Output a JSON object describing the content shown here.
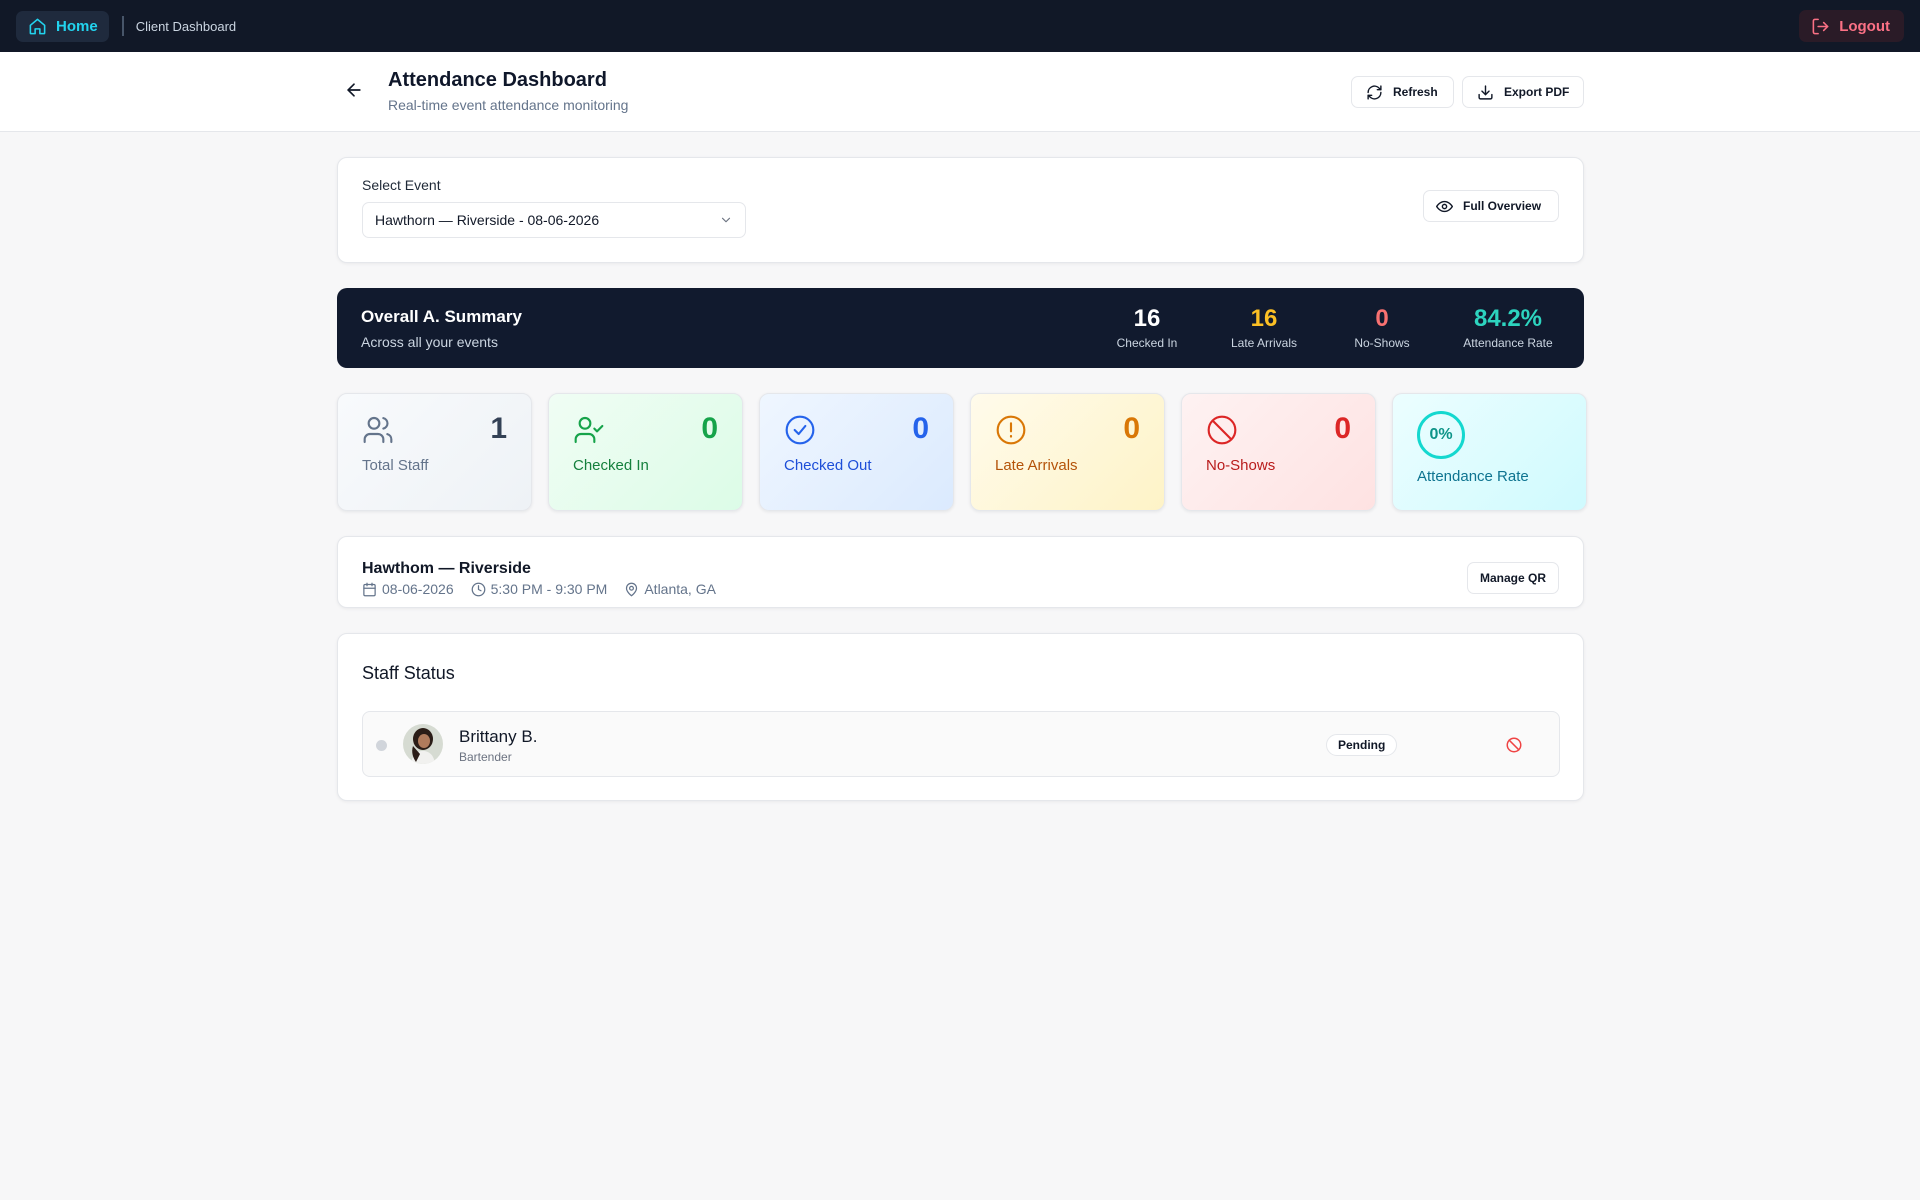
{
  "nav": {
    "home_label": "Home",
    "breadcrumb": "Client Dashboard",
    "logout_label": "Logout"
  },
  "header": {
    "title": "Attendance Dashboard",
    "subtitle": "Real-time event attendance monitoring",
    "refresh_label": "Refresh",
    "export_label": "Export PDF"
  },
  "event_select": {
    "label": "Select Event",
    "selected": "Hawthorn — Riverside - 08-06-2026",
    "overview_label": "Full Overview"
  },
  "summary": {
    "title": "Overall A. Summary",
    "subtitle": "Across all your events",
    "stats": [
      {
        "value": "16",
        "label": "Checked In",
        "color": "#ffffff"
      },
      {
        "value": "16",
        "label": "Late Arrivals",
        "color": "#fbbf24"
      },
      {
        "value": "0",
        "label": "No-Shows",
        "color": "#f87171"
      },
      {
        "value": "84.2%",
        "label": "Attendance Rate",
        "color": "#2dd4bf"
      }
    ]
  },
  "tiles": [
    {
      "value": "1",
      "label": "Total Staff",
      "icon": "users-icon"
    },
    {
      "value": "0",
      "label": "Checked In",
      "icon": "user-check-icon"
    },
    {
      "value": "0",
      "label": "Checked Out",
      "icon": "check-circle-icon"
    },
    {
      "value": "0",
      "label": "Late Arrivals",
      "icon": "alert-circle-icon"
    },
    {
      "value": "0",
      "label": "No-Shows",
      "icon": "ban-icon"
    },
    {
      "value": "0%",
      "label": "Attendance Rate",
      "icon": "progress-ring"
    }
  ],
  "event": {
    "name": "Hawthom — Riverside",
    "date": "08-06-2026",
    "time": "5:30 PM - 9:30 PM",
    "location": "Atlanta, GA",
    "qr_label": "Manage QR"
  },
  "staff": {
    "title": "Staff Status",
    "rows": [
      {
        "name": "Brittany B.",
        "role": "Bartender",
        "status": "Pending"
      }
    ]
  }
}
